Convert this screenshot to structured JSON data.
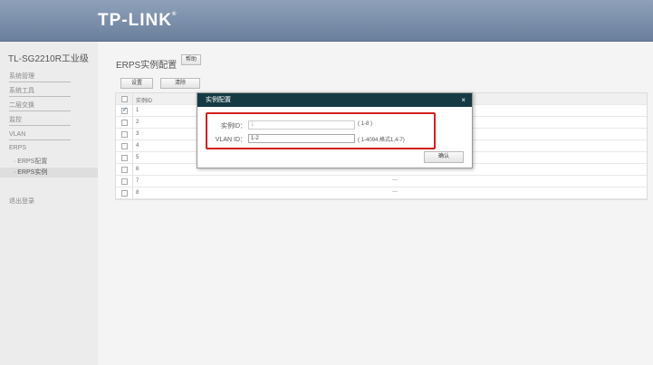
{
  "header": {
    "logo": "TP-LINK",
    "trademark": "®"
  },
  "sidebar": {
    "model": "TL-SG2210R工业级",
    "items": [
      "系统管理",
      "系统工具",
      "二层交换",
      "监控",
      "VLAN"
    ],
    "erps_label": "ERPS",
    "sub_items": [
      "· ERPS配置",
      "· ERPS实例"
    ],
    "logout": "退出登录"
  },
  "main": {
    "title": "ERPS实例配置",
    "help": "帮助",
    "set_button": "设置",
    "clear_button": "清除",
    "table": {
      "header_id": "实例ID",
      "rows": [
        {
          "id": "1",
          "vlan": "",
          "checked": true
        },
        {
          "id": "2",
          "vlan": ""
        },
        {
          "id": "3",
          "vlan": ""
        },
        {
          "id": "4",
          "vlan": ""
        },
        {
          "id": "5",
          "vlan": ""
        },
        {
          "id": "6",
          "vlan": "---"
        },
        {
          "id": "7",
          "vlan": "---"
        },
        {
          "id": "8",
          "vlan": "---"
        }
      ]
    }
  },
  "dialog": {
    "title": "实例配置",
    "close": "×",
    "instance_label": "实例ID：",
    "instance_value": "1",
    "instance_hint": "( 1-8 )",
    "vlan_label": "VLAN ID：",
    "vlan_value": "1-2",
    "vlan_hint": "( 1-4094,格式1,4-7)",
    "ok": "确认"
  },
  "colors": {
    "header": "#6a7f9c",
    "dialog_title": "#153a44",
    "highlight": "#d42020"
  }
}
